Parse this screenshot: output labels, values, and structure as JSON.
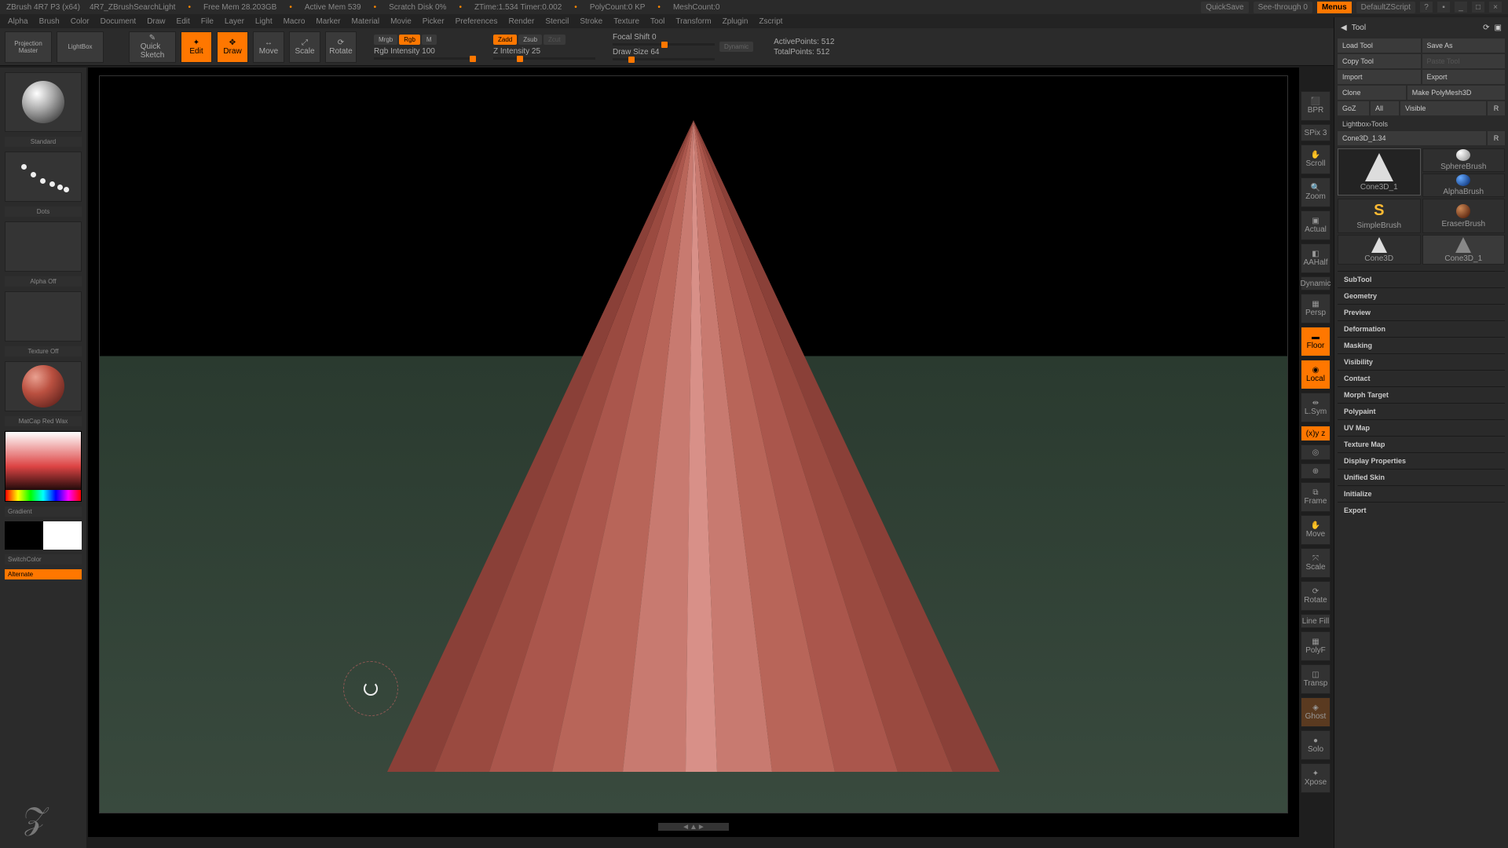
{
  "title": {
    "app": "ZBrush 4R7 P3 (x64)",
    "doc": "4R7_ZBrushSearchLight",
    "free_mem": "Free Mem 28.203GB",
    "active_mem": "Active Mem 539",
    "scratch": "Scratch Disk 0%",
    "ztime": "ZTime:1.534 Timer:0.002",
    "polycount": "PolyCount:0 KP",
    "meshcount": "MeshCount:0",
    "quicksave": "QuickSave",
    "seethrough": "See-through  0",
    "menus": "Menus",
    "script": "DefaultZScript"
  },
  "menus": [
    "Alpha",
    "Brush",
    "Color",
    "Document",
    "Draw",
    "Edit",
    "File",
    "Layer",
    "Light",
    "Macro",
    "Marker",
    "Material",
    "Movie",
    "Picker",
    "Preferences",
    "Render",
    "Stencil",
    "Stroke",
    "Texture",
    "Tool",
    "Transform",
    "Zplugin",
    "Zscript"
  ],
  "toolbar": {
    "projection": "Projection\nMaster",
    "lightbox": "LightBox",
    "quicksketch": "Quick\nSketch",
    "edit": "Edit",
    "draw": "Draw",
    "move": "Move",
    "scale": "Scale",
    "rotate": "Rotate",
    "mrgb": "Mrgb",
    "rgb": "Rgb",
    "m": "M",
    "rgb_intensity": "Rgb Intensity 100",
    "zadd": "Zadd",
    "zsub": "Zsub",
    "zcut": "Zcut",
    "z_intensity": "Z Intensity 25",
    "focal": "Focal Shift 0",
    "drawsize": "Draw Size 64",
    "dynamic": "Dynamic",
    "active_pts": "ActivePoints: 512",
    "total_pts": "TotalPoints: 512"
  },
  "left": {
    "standard": "Standard",
    "dots": "Dots",
    "alpha": "Alpha Off",
    "texture": "Texture Off",
    "matcap": "MatCap Red Wax",
    "gradient": "Gradient",
    "switchcolor": "SwitchColor",
    "alternate": "Alternate"
  },
  "ricons": {
    "bpr": "BPR",
    "spix": "SPix 3",
    "scroll": "Scroll",
    "zoom": "Zoom",
    "actual": "Actual",
    "aahalf": "AAHalf",
    "dynamic": "Dynamic",
    "persp": "Persp",
    "floor": "Floor",
    "local": "Local",
    "lsym": "L.Sym",
    "xyz": "(x)y z",
    "frame": "Frame",
    "move": "Move",
    "scale": "Scale",
    "rotate": "Rotate",
    "linefill": "Line Fill",
    "polyf": "PolyF",
    "transp": "Transp",
    "ghost": "Ghost",
    "solo": "Solo",
    "xpose": "Xpose"
  },
  "tool": {
    "header": "Tool",
    "load": "Load Tool",
    "save": "Save As",
    "copy": "Copy Tool",
    "paste": "Paste Tool",
    "import": "Import",
    "export_top": "Export",
    "clone": "Clone",
    "polymesh": "Make PolyMesh3D",
    "goz": "GoZ",
    "all": "All",
    "visible": "Visible",
    "r": "R",
    "lbtools": "Lightbox›Tools",
    "objname": "Cone3D_1.34",
    "r2": "R",
    "cell_cone": "Cone3D_1",
    "cell_sphere": "SphereBrush",
    "cell_simple": "SimpleBrush",
    "cell_alpha": "AlphaBrush",
    "cell_eraser": "EraserBrush",
    "cell_cone2": "Cone3D",
    "cell_cone3": "Cone3D_1",
    "sections": [
      "SubTool",
      "Geometry",
      "Preview",
      "Deformation",
      "Masking",
      "Visibility",
      "Contact",
      "Morph Target",
      "Polypaint",
      "UV Map",
      "Texture Map",
      "Display Properties",
      "Unified Skin",
      "Initialize",
      "Export"
    ]
  }
}
